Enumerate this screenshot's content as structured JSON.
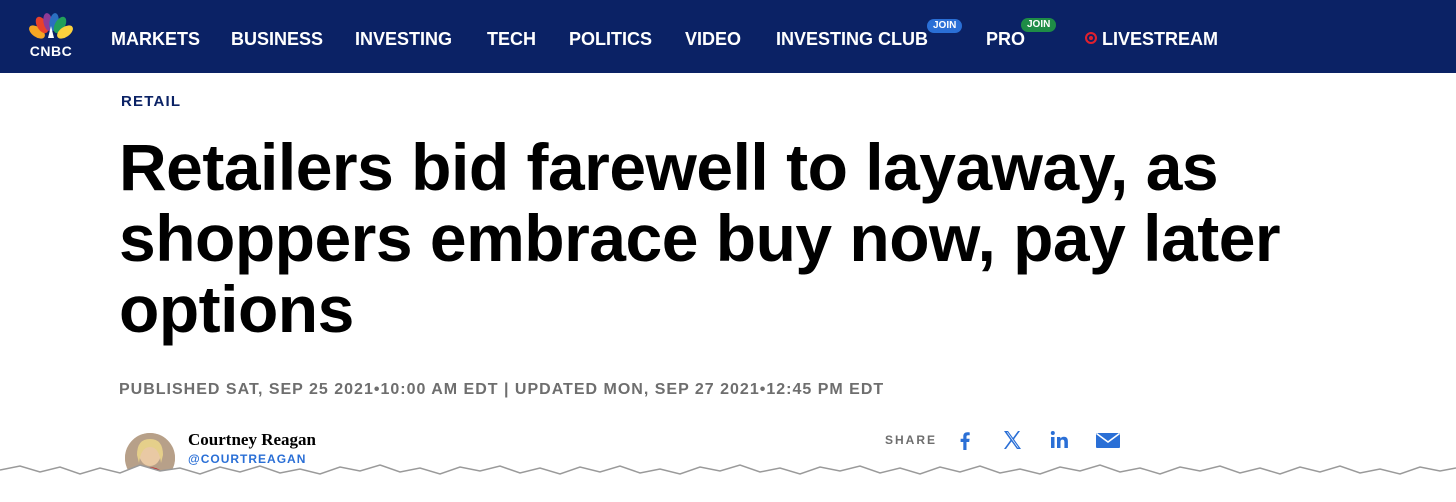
{
  "brand": {
    "logo_text": "CNBC"
  },
  "nav": {
    "items": [
      {
        "label": "MARKETS"
      },
      {
        "label": "BUSINESS"
      },
      {
        "label": "INVESTING"
      },
      {
        "label": "TECH"
      },
      {
        "label": "POLITICS"
      },
      {
        "label": "VIDEO"
      },
      {
        "label": "INVESTING CLUB",
        "badge": "JOIN"
      },
      {
        "label": "PRO",
        "badge": "JOIN"
      },
      {
        "label": "LIVESTREAM"
      }
    ]
  },
  "article": {
    "section": "RETAIL",
    "headline": "Retailers bid farewell to layaway, as shoppers embrace buy now, pay later options",
    "dates": "PUBLISHED SAT, SEP 25 2021•10:00 AM EDT | UPDATED MON, SEP 27 2021•12:45 PM EDT",
    "author": {
      "name": "Courtney Reagan",
      "handle": "@COURTREAGAN"
    }
  },
  "share": {
    "label": "SHARE",
    "icons": [
      "facebook-icon",
      "x-twitter-icon",
      "linkedin-icon",
      "email-icon"
    ]
  },
  "colors": {
    "nav_bg": "#0b2265",
    "accent_blue": "#2a6fd6",
    "badge_green": "#1e8c46",
    "live_red": "#e0202e"
  }
}
